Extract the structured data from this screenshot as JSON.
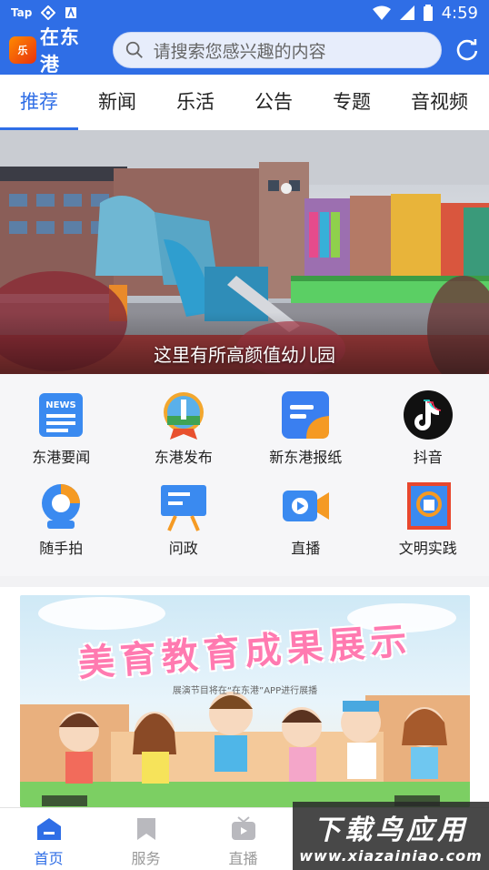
{
  "status_bar": {
    "carrier_label": "Tap",
    "time": "4:59",
    "icons": [
      "app-icon",
      "a-icon",
      "wifi-icon",
      "signal-icon",
      "battery-icon"
    ]
  },
  "header": {
    "logo_text": "乐",
    "app_title": "在东港",
    "search_placeholder": "请搜索您感兴趣的内容",
    "accent_color": "#2f6ee6"
  },
  "tabs": [
    {
      "label": "推荐",
      "active": true
    },
    {
      "label": "新闻",
      "active": false
    },
    {
      "label": "乐活",
      "active": false
    },
    {
      "label": "公告",
      "active": false
    },
    {
      "label": "专题",
      "active": false
    },
    {
      "label": "音视频",
      "active": false
    }
  ],
  "banner": {
    "caption": "这里有所高颜值幼儿园"
  },
  "grid": [
    {
      "label": "东港要闻",
      "icon": "news-icon"
    },
    {
      "label": "东港发布",
      "icon": "lighthouse-badge-icon"
    },
    {
      "label": "新东港报纸",
      "icon": "newspaper-icon"
    },
    {
      "label": "抖音",
      "icon": "tiktok-icon"
    },
    {
      "label": "随手拍",
      "icon": "camera-icon"
    },
    {
      "label": "问政",
      "icon": "easel-icon"
    },
    {
      "label": "直播",
      "icon": "video-icon"
    },
    {
      "label": "文明实践",
      "icon": "book-icon"
    }
  ],
  "poster": {
    "title": "美育教育成果展示",
    "subtitle": "展演节目将在“在东港”APP进行展播"
  },
  "bottom_nav": [
    {
      "label": "首页",
      "icon": "home-icon",
      "active": true
    },
    {
      "label": "服务",
      "icon": "bookmark-icon",
      "active": false
    },
    {
      "label": "直播",
      "icon": "tv-icon",
      "active": false
    }
  ],
  "watermark": {
    "title": "下载鸟应用",
    "url": "www.xiazainiao.com"
  }
}
